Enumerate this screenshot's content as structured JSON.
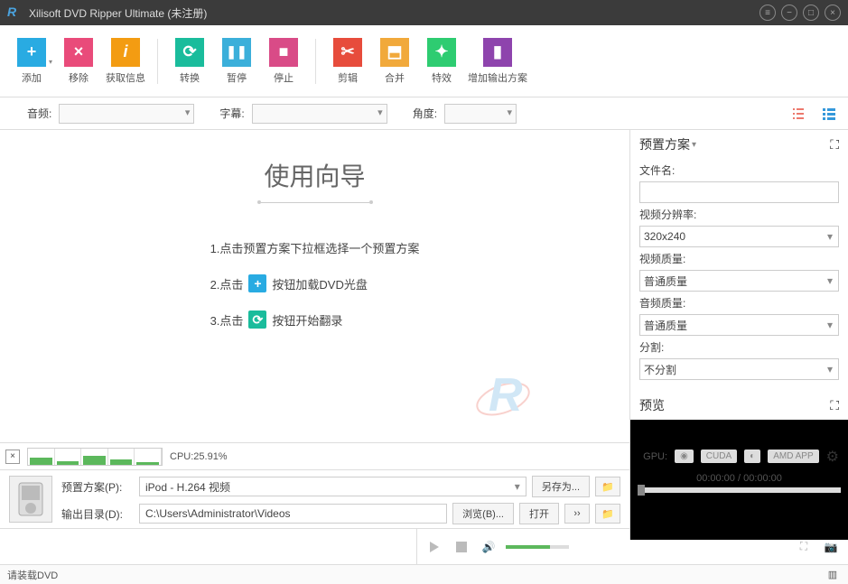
{
  "titlebar": {
    "title": "Xilisoft DVD Ripper Ultimate (未注册)"
  },
  "toolbar": {
    "add": "添加",
    "remove": "移除",
    "getinfo": "获取信息",
    "convert": "转换",
    "pause": "暂停",
    "stop": "停止",
    "clip": "剪辑",
    "merge": "合并",
    "effect": "特效",
    "addprofile": "增加输出方案"
  },
  "filters": {
    "audio": "音频:",
    "subtitle": "字幕:",
    "angle": "角度:"
  },
  "wizard": {
    "title": "使用向导",
    "step1": "1.点击预置方案下拉框选择一个预置方案",
    "step2a": "2.点击",
    "step2b": "按钮加载DVD光盘",
    "step3a": "3.点击",
    "step3b": "按钮开始翻录"
  },
  "right": {
    "preset_head": "预置方案",
    "filename": "文件名:",
    "vres": "视频分辨率:",
    "vres_val": "320x240",
    "vq": "视频质量:",
    "vq_val": "普通质量",
    "aq": "音频质量:",
    "aq_val": "普通质量",
    "split": "分割:",
    "split_val": "不分割",
    "preview": "预览"
  },
  "stats": {
    "cpu_label": "CPU:25.91%",
    "gpu_label": "GPU:",
    "cuda": "CUDA",
    "amd": "AMD APP"
  },
  "bottom": {
    "profile_lbl": "预置方案(P):",
    "profile_val": "iPod - H.264 视频",
    "saveas": "另存为...",
    "output_lbl": "输出目录(D):",
    "output_val": "C:\\Users\\Administrator\\Videos",
    "browse": "浏览(B)...",
    "open": "打开"
  },
  "time": {
    "current": "00:00:00",
    "total": "00:00:00"
  },
  "status": {
    "text": "请装载DVD"
  }
}
